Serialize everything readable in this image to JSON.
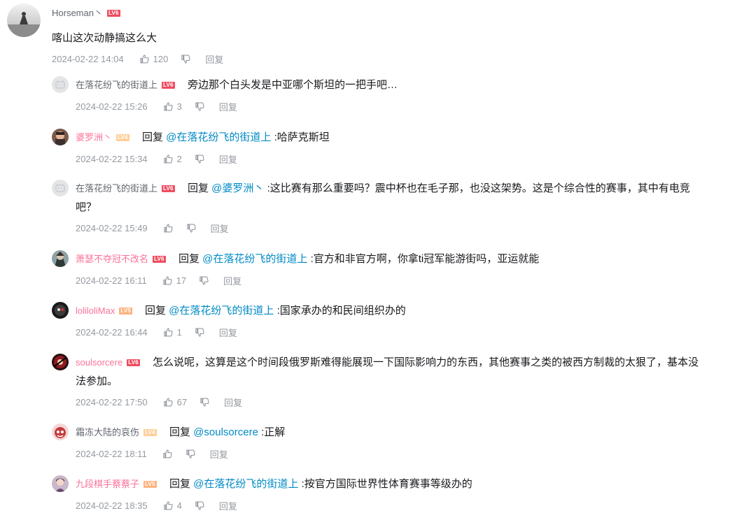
{
  "main": {
    "username": "Horseman丶",
    "level": "LV6",
    "text": "喀山这次动静搞这么大",
    "time": "2024-02-22 14:04",
    "likes": "120",
    "reply_label": "回复"
  },
  "replies": [
    {
      "username": "在落花纷飞的街道上",
      "level": "LV6",
      "prefix": "",
      "mention": "",
      "text": "旁边那个白头发是中亚哪个斯坦的一把手吧…",
      "text2": "",
      "time": "2024-02-22 15:26",
      "likes": "3",
      "reply_label": "回复"
    },
    {
      "username": "婆罗洲丶",
      "level": "LV4",
      "prefix": "回复 ",
      "mention": "@在落花纷飞的街道上",
      "text": " :哈萨克斯坦",
      "text2": "",
      "time": "2024-02-22 15:34",
      "likes": "2",
      "reply_label": "回复"
    },
    {
      "username": "在落花纷飞的街道上",
      "level": "LV6",
      "prefix": "回复 ",
      "mention": "@婆罗洲丶",
      "text": " :这比赛有那么重要吗？震中杯也在毛子那，也没这架势。这是个综合性的赛事，其中有电竞",
      "text2": "吧？",
      "time": "2024-02-22 15:49",
      "likes": "",
      "reply_label": "回复"
    },
    {
      "username": "萧瑟不夺冠不改名",
      "level": "LV6",
      "prefix": "回复 ",
      "mention": "@在落花纷飞的街道上",
      "text": " :官方和非官方啊，你拿ti冠军能游街吗，亚运就能",
      "text2": "",
      "time": "2024-02-22 16:11",
      "likes": "17",
      "reply_label": "回复"
    },
    {
      "username": "loliloliMax",
      "level": "LV5",
      "prefix": "回复 ",
      "mention": "@在落花纷飞的街道上",
      "text": " :国家承办的和民间组织办的",
      "text2": "",
      "time": "2024-02-22 16:44",
      "likes": "1",
      "reply_label": "回复"
    },
    {
      "username": "soulsorcere",
      "level": "LV6",
      "prefix": "",
      "mention": "",
      "text": "怎么说呢，这算是这个时间段俄罗斯难得能展现一下国际影响力的东西，其他赛事之类的被西方制裁的太狠了，基本没",
      "text2": "法参加。",
      "time": "2024-02-22 17:50",
      "likes": "67",
      "reply_label": "回复"
    },
    {
      "username": "霜冻大陆的哀伤",
      "level": "LV4",
      "prefix": "回复 ",
      "mention": "@soulsorcere",
      "text": " :正解",
      "text2": "",
      "time": "2024-02-22 18:11",
      "likes": "",
      "reply_label": "回复"
    },
    {
      "username": "九段棋手蔡蔡子",
      "level": "LV5",
      "prefix": "回复 ",
      "mention": "@在落花纷飞的街道上",
      "text": " :按官方国际世界性体育赛事等级办的",
      "text2": "",
      "time": "2024-02-22 18:35",
      "likes": "4",
      "reply_label": "回复"
    }
  ],
  "colors": {
    "accent_link": "#008ac5",
    "name_pink": "#fb7299",
    "meta_gray": "#9499a0",
    "level_red": "#ee4d5f",
    "level_orange": "#ffb27f"
  }
}
